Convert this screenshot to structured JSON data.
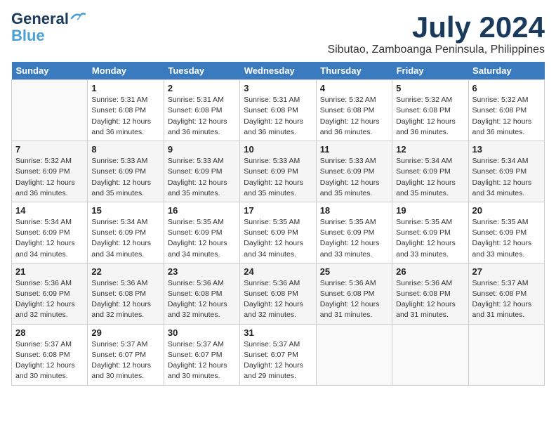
{
  "logo": {
    "line1a": "General",
    "line1b": "Blue"
  },
  "title": "July 2024",
  "location": "Sibutao, Zamboanga Peninsula, Philippines",
  "weekdays": [
    "Sunday",
    "Monday",
    "Tuesday",
    "Wednesday",
    "Thursday",
    "Friday",
    "Saturday"
  ],
  "weeks": [
    [
      {
        "day": "",
        "info": ""
      },
      {
        "day": "1",
        "info": "Sunrise: 5:31 AM\nSunset: 6:08 PM\nDaylight: 12 hours\nand 36 minutes."
      },
      {
        "day": "2",
        "info": "Sunrise: 5:31 AM\nSunset: 6:08 PM\nDaylight: 12 hours\nand 36 minutes."
      },
      {
        "day": "3",
        "info": "Sunrise: 5:31 AM\nSunset: 6:08 PM\nDaylight: 12 hours\nand 36 minutes."
      },
      {
        "day": "4",
        "info": "Sunrise: 5:32 AM\nSunset: 6:08 PM\nDaylight: 12 hours\nand 36 minutes."
      },
      {
        "day": "5",
        "info": "Sunrise: 5:32 AM\nSunset: 6:08 PM\nDaylight: 12 hours\nand 36 minutes."
      },
      {
        "day": "6",
        "info": "Sunrise: 5:32 AM\nSunset: 6:08 PM\nDaylight: 12 hours\nand 36 minutes."
      }
    ],
    [
      {
        "day": "7",
        "info": "Sunrise: 5:32 AM\nSunset: 6:09 PM\nDaylight: 12 hours\nand 36 minutes."
      },
      {
        "day": "8",
        "info": "Sunrise: 5:33 AM\nSunset: 6:09 PM\nDaylight: 12 hours\nand 35 minutes."
      },
      {
        "day": "9",
        "info": "Sunrise: 5:33 AM\nSunset: 6:09 PM\nDaylight: 12 hours\nand 35 minutes."
      },
      {
        "day": "10",
        "info": "Sunrise: 5:33 AM\nSunset: 6:09 PM\nDaylight: 12 hours\nand 35 minutes."
      },
      {
        "day": "11",
        "info": "Sunrise: 5:33 AM\nSunset: 6:09 PM\nDaylight: 12 hours\nand 35 minutes."
      },
      {
        "day": "12",
        "info": "Sunrise: 5:34 AM\nSunset: 6:09 PM\nDaylight: 12 hours\nand 35 minutes."
      },
      {
        "day": "13",
        "info": "Sunrise: 5:34 AM\nSunset: 6:09 PM\nDaylight: 12 hours\nand 34 minutes."
      }
    ],
    [
      {
        "day": "14",
        "info": "Sunrise: 5:34 AM\nSunset: 6:09 PM\nDaylight: 12 hours\nand 34 minutes."
      },
      {
        "day": "15",
        "info": "Sunrise: 5:34 AM\nSunset: 6:09 PM\nDaylight: 12 hours\nand 34 minutes."
      },
      {
        "day": "16",
        "info": "Sunrise: 5:35 AM\nSunset: 6:09 PM\nDaylight: 12 hours\nand 34 minutes."
      },
      {
        "day": "17",
        "info": "Sunrise: 5:35 AM\nSunset: 6:09 PM\nDaylight: 12 hours\nand 34 minutes."
      },
      {
        "day": "18",
        "info": "Sunrise: 5:35 AM\nSunset: 6:09 PM\nDaylight: 12 hours\nand 33 minutes."
      },
      {
        "day": "19",
        "info": "Sunrise: 5:35 AM\nSunset: 6:09 PM\nDaylight: 12 hours\nand 33 minutes."
      },
      {
        "day": "20",
        "info": "Sunrise: 5:35 AM\nSunset: 6:09 PM\nDaylight: 12 hours\nand 33 minutes."
      }
    ],
    [
      {
        "day": "21",
        "info": "Sunrise: 5:36 AM\nSunset: 6:09 PM\nDaylight: 12 hours\nand 32 minutes."
      },
      {
        "day": "22",
        "info": "Sunrise: 5:36 AM\nSunset: 6:08 PM\nDaylight: 12 hours\nand 32 minutes."
      },
      {
        "day": "23",
        "info": "Sunrise: 5:36 AM\nSunset: 6:08 PM\nDaylight: 12 hours\nand 32 minutes."
      },
      {
        "day": "24",
        "info": "Sunrise: 5:36 AM\nSunset: 6:08 PM\nDaylight: 12 hours\nand 32 minutes."
      },
      {
        "day": "25",
        "info": "Sunrise: 5:36 AM\nSunset: 6:08 PM\nDaylight: 12 hours\nand 31 minutes."
      },
      {
        "day": "26",
        "info": "Sunrise: 5:36 AM\nSunset: 6:08 PM\nDaylight: 12 hours\nand 31 minutes."
      },
      {
        "day": "27",
        "info": "Sunrise: 5:37 AM\nSunset: 6:08 PM\nDaylight: 12 hours\nand 31 minutes."
      }
    ],
    [
      {
        "day": "28",
        "info": "Sunrise: 5:37 AM\nSunset: 6:08 PM\nDaylight: 12 hours\nand 30 minutes."
      },
      {
        "day": "29",
        "info": "Sunrise: 5:37 AM\nSunset: 6:07 PM\nDaylight: 12 hours\nand 30 minutes."
      },
      {
        "day": "30",
        "info": "Sunrise: 5:37 AM\nSunset: 6:07 PM\nDaylight: 12 hours\nand 30 minutes."
      },
      {
        "day": "31",
        "info": "Sunrise: 5:37 AM\nSunset: 6:07 PM\nDaylight: 12 hours\nand 29 minutes."
      },
      {
        "day": "",
        "info": ""
      },
      {
        "day": "",
        "info": ""
      },
      {
        "day": "",
        "info": ""
      }
    ]
  ]
}
